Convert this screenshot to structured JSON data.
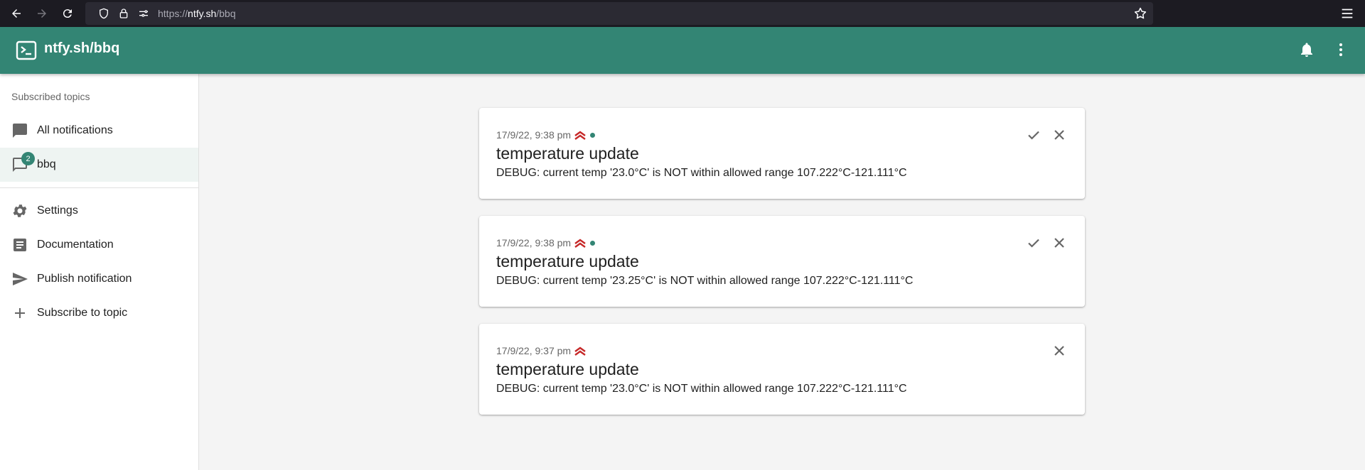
{
  "browser": {
    "url_protocol": "https://",
    "url_host": "ntfy.sh",
    "url_path": "/bbq"
  },
  "app": {
    "title": "ntfy.sh/bbq",
    "accent_color": "#338574",
    "logo_icon": "terminal-logo-icon"
  },
  "sidebar": {
    "heading": "Subscribed topics",
    "items": [
      {
        "label": "All notifications",
        "icon": "chat-icon"
      },
      {
        "label": "bbq",
        "icon": "chat-outline-icon",
        "badge": "2",
        "active": true
      },
      {
        "label": "Settings",
        "icon": "gear-icon"
      },
      {
        "label": "Documentation",
        "icon": "article-icon"
      },
      {
        "label": "Publish notification",
        "icon": "send-icon"
      },
      {
        "label": "Subscribe to topic",
        "icon": "plus-icon"
      }
    ]
  },
  "notifications": [
    {
      "time": "17/9/22, 9:38 pm",
      "priority_icon": "priority-high-icon",
      "new": true,
      "title": "temperature update",
      "message": "DEBUG: current temp '23.0°C' is NOT within allowed range 107.222°C-121.111°C"
    },
    {
      "time": "17/9/22, 9:38 pm",
      "priority_icon": "priority-high-icon",
      "new": true,
      "title": "temperature update",
      "message": "DEBUG: current temp '23.25°C' is NOT within allowed range 107.222°C-121.111°C"
    },
    {
      "time": "17/9/22, 9:37 pm",
      "priority_icon": "priority-high-icon",
      "new": false,
      "title": "temperature update",
      "message": "DEBUG: current temp '23.0°C' is NOT within allowed range 107.222°C-121.111°C"
    }
  ]
}
